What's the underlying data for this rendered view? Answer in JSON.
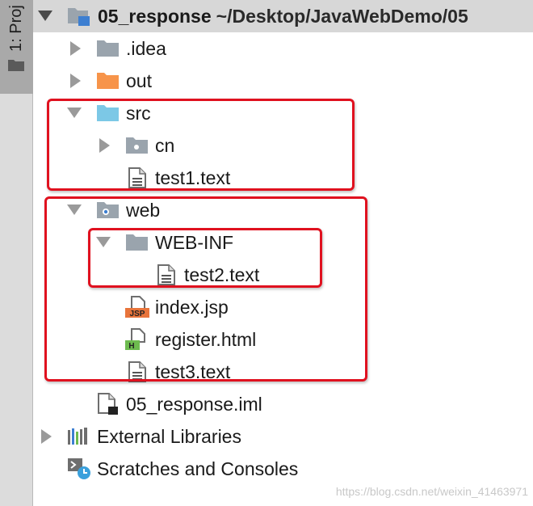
{
  "sidebar": {
    "tab_label": "1: Proj"
  },
  "tree": {
    "root": {
      "name": "05_response",
      "path": "~/Desktop/JavaWebDemo/05"
    },
    "idea": ".idea",
    "out": "out",
    "src": "src",
    "cn": "cn",
    "test1": "test1.text",
    "web": "web",
    "web_inf": "WEB-INF",
    "test2": "test2.text",
    "index_jsp": "index.jsp",
    "register_html": "register.html",
    "test3": "test3.text",
    "iml": "05_response.iml",
    "external_libraries": "External Libraries",
    "scratches": "Scratches and Consoles"
  },
  "icon_badges": {
    "jsp": "JSP",
    "html": "H"
  },
  "watermark": "https://blog.csdn.net/weixin_41463971",
  "colors": {
    "selection": "#d7d7d7",
    "highlight_box": "#e0111f",
    "folder_gray": "#9aa4ad",
    "folder_orange": "#f7944a",
    "folder_blue": "#7cc8e6",
    "module_blue": "#3d7fd1"
  }
}
